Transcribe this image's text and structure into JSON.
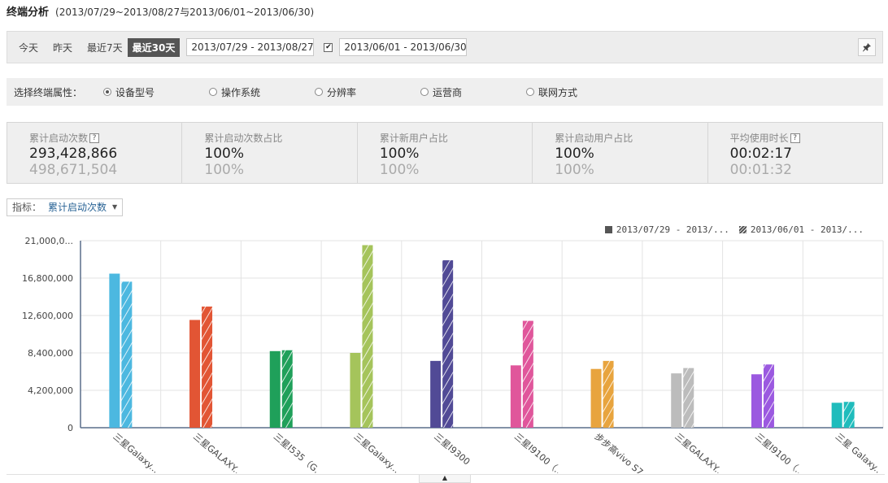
{
  "page": {
    "title": "终端分析",
    "subtitle": "(2013/07/29~2013/08/27与2013/06/01~2013/06/30)"
  },
  "toolbar": {
    "quick_ranges": [
      "今天",
      "昨天",
      "最近7天",
      "最近30天"
    ],
    "active_range": "最近30天",
    "date_range_1": "2013/07/29 - 2013/08/27",
    "compare_checked": true,
    "date_range_2": "2013/06/01 - 2013/06/30",
    "pin_icon": "pin-icon"
  },
  "attributes": {
    "label": "选择终端属性：",
    "options": [
      "设备型号",
      "操作系统",
      "分辨率",
      "运营商",
      "联网方式"
    ],
    "selected": "设备型号"
  },
  "stats": [
    {
      "label": "累计启动次数",
      "help": true,
      "current": "293,428,866",
      "previous": "498,671,504"
    },
    {
      "label": "累计启动次数占比",
      "help": false,
      "current": "100%",
      "previous": "100%"
    },
    {
      "label": "累计新用户占比",
      "help": false,
      "current": "100%",
      "previous": "100%"
    },
    {
      "label": "累计启动用户占比",
      "help": false,
      "current": "100%",
      "previous": "100%"
    },
    {
      "label": "平均使用时长",
      "help": true,
      "current": "00:02:17",
      "previous": "00:01:32"
    }
  ],
  "metric": {
    "label": "指标：",
    "value": "累计启动次数"
  },
  "chart_data": {
    "type": "bar",
    "categories": [
      "三星Galaxy...",
      "三星GALAXY...",
      "三星I535（G...",
      "三星Galaxy...",
      "三星I9300",
      "三星I9100（...",
      "步步高vivo S7...",
      "三星GALAXY...",
      "三星I9100（...",
      "三星 Galaxy..."
    ],
    "series": [
      {
        "name": "2013/07/29 - 2013/...",
        "values": [
          17300000,
          12100000,
          8600000,
          8400000,
          7500000,
          7000000,
          6600000,
          6100000,
          6000000,
          2800000
        ]
      },
      {
        "name": "2013/06/01 - 2013/...",
        "values": [
          16400000,
          13600000,
          8700000,
          20500000,
          18800000,
          12000000,
          7500000,
          6700000,
          7100000,
          2900000
        ]
      }
    ],
    "bar_colors": [
      "#4cb8e0",
      "#e25534",
      "#1fa05a",
      "#a5c45b",
      "#514a96",
      "#e0569b",
      "#e8a43e",
      "#bcbcbc",
      "#9b59e0",
      "#1fbcbc"
    ],
    "y_ticks": [
      "0",
      "4,200,000",
      "8,400,000",
      "12,600,000",
      "16,800,000",
      "21,000,0..."
    ],
    "ylim": [
      0,
      21000000
    ],
    "grid": true,
    "legend": "top-right"
  }
}
